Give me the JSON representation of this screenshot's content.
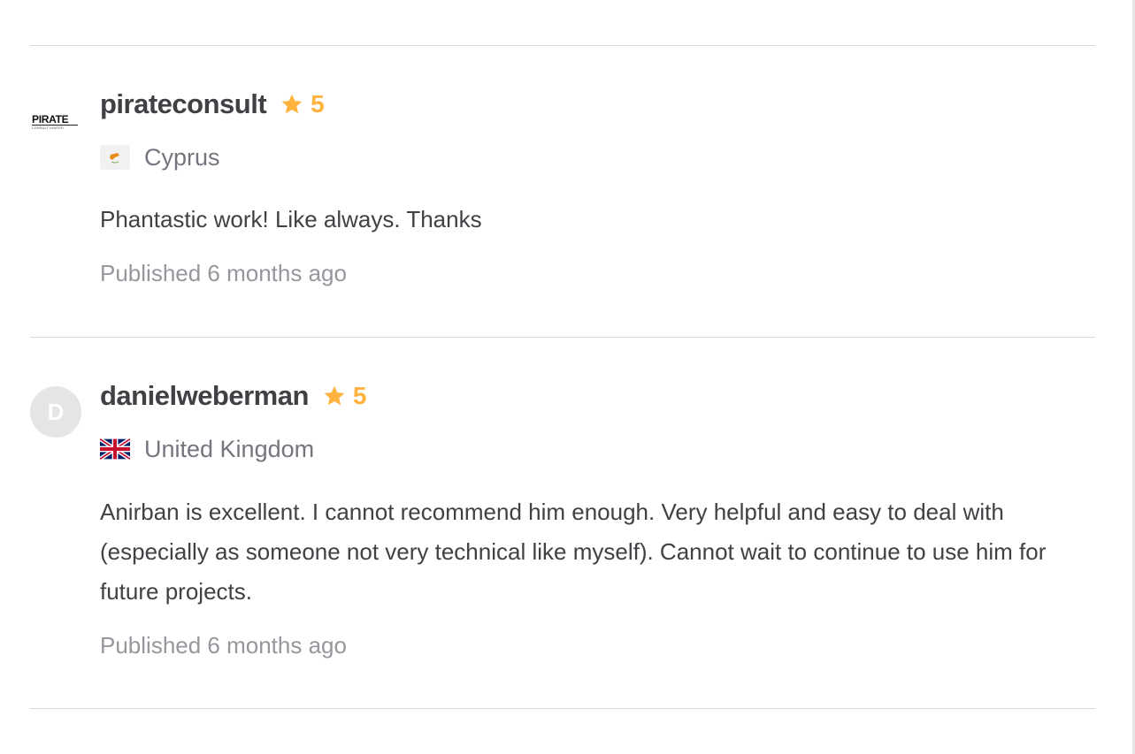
{
  "reviews": [
    {
      "avatar": {
        "logo_text": "PIRATE",
        "logo_subtext": "CONSULT LIMITED"
      },
      "username": "pirateconsult",
      "rating": "5",
      "country": "Cyprus",
      "flag_icon": "cyprus-flag-icon",
      "comment": "Phantastic work! Like always. Thanks",
      "published": "Published 6 months ago"
    },
    {
      "avatar": {
        "initial": "D"
      },
      "username": "danielweberman",
      "rating": "5",
      "country": "United Kingdom",
      "flag_icon": "uk-flag-icon",
      "comment": "Anirban is excellent. I cannot recommend him enough. Very helpful and easy to deal with (especially as someone not very technical like myself). Cannot wait to continue to use him for future projects.",
      "published": "Published 6 months ago"
    }
  ],
  "colors": {
    "star": "#ffb33e",
    "username": "#404145",
    "country": "#74767e",
    "published": "#95979d",
    "divider": "#dadbdd",
    "avatar_bg": "#e4e5e7"
  }
}
